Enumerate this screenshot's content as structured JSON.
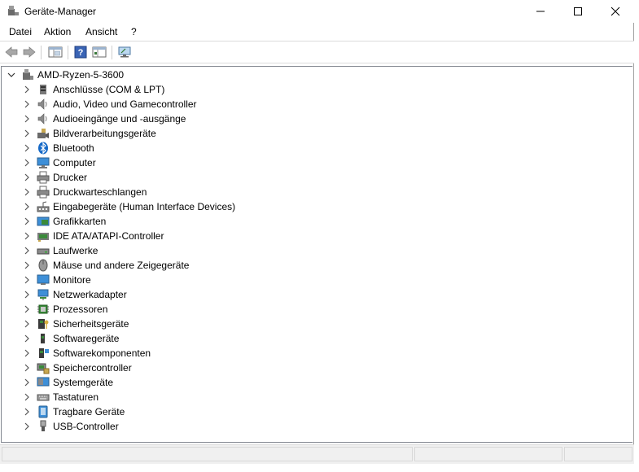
{
  "window": {
    "title": "Geräte-Manager"
  },
  "titlebar": {
    "minimize_icon": "minimize-icon",
    "maximize_icon": "maximize-icon",
    "close_icon": "close-icon"
  },
  "menu": {
    "items": [
      "Datei",
      "Aktion",
      "Ansicht",
      "?"
    ]
  },
  "toolbar": {
    "icons": [
      "back-arrow-icon",
      "forward-arrow-icon",
      "properties-icon",
      "help-icon",
      "details-view-icon",
      "computer-monitor-icon"
    ]
  },
  "tree": {
    "root": "AMD-Ryzen-5-3600",
    "items": [
      {
        "label": "Anschlüsse (COM & LPT)",
        "icon": "port-icon"
      },
      {
        "label": "Audio, Video und Gamecontroller",
        "icon": "speaker-icon"
      },
      {
        "label": "Audioeingänge und -ausgänge",
        "icon": "speaker-icon"
      },
      {
        "label": "Bildverarbeitungsgeräte",
        "icon": "camera-icon"
      },
      {
        "label": "Bluetooth",
        "icon": "bluetooth-icon"
      },
      {
        "label": "Computer",
        "icon": "computer-icon"
      },
      {
        "label": "Drucker",
        "icon": "printer-icon"
      },
      {
        "label": "Druckwarteschlangen",
        "icon": "printer-icon"
      },
      {
        "label": "Eingabegeräte (Human Interface Devices)",
        "icon": "hid-icon"
      },
      {
        "label": "Grafikkarten",
        "icon": "display-adapter-icon"
      },
      {
        "label": "IDE ATA/ATAPI-Controller",
        "icon": "ide-controller-icon"
      },
      {
        "label": "Laufwerke",
        "icon": "drive-icon"
      },
      {
        "label": "Mäuse und andere Zeigegeräte",
        "icon": "mouse-icon"
      },
      {
        "label": "Monitore",
        "icon": "monitor-icon"
      },
      {
        "label": "Netzwerkadapter",
        "icon": "network-icon"
      },
      {
        "label": "Prozessoren",
        "icon": "processor-icon"
      },
      {
        "label": "Sicherheitsgeräte",
        "icon": "security-key-icon"
      },
      {
        "label": "Softwaregeräte",
        "icon": "software-device-icon"
      },
      {
        "label": "Softwarekomponenten",
        "icon": "software-component-icon"
      },
      {
        "label": "Speichercontroller",
        "icon": "storage-controller-icon"
      },
      {
        "label": "Systemgeräte",
        "icon": "system-device-icon"
      },
      {
        "label": "Tastaturen",
        "icon": "keyboard-icon"
      },
      {
        "label": "Tragbare Geräte",
        "icon": "portable-device-icon"
      },
      {
        "label": "USB-Controller",
        "icon": "usb-icon"
      }
    ]
  },
  "colors": {
    "selection": "#cce8ff",
    "status_bar": "#f0f0f0",
    "background_window_text": "#2e8b2e"
  }
}
